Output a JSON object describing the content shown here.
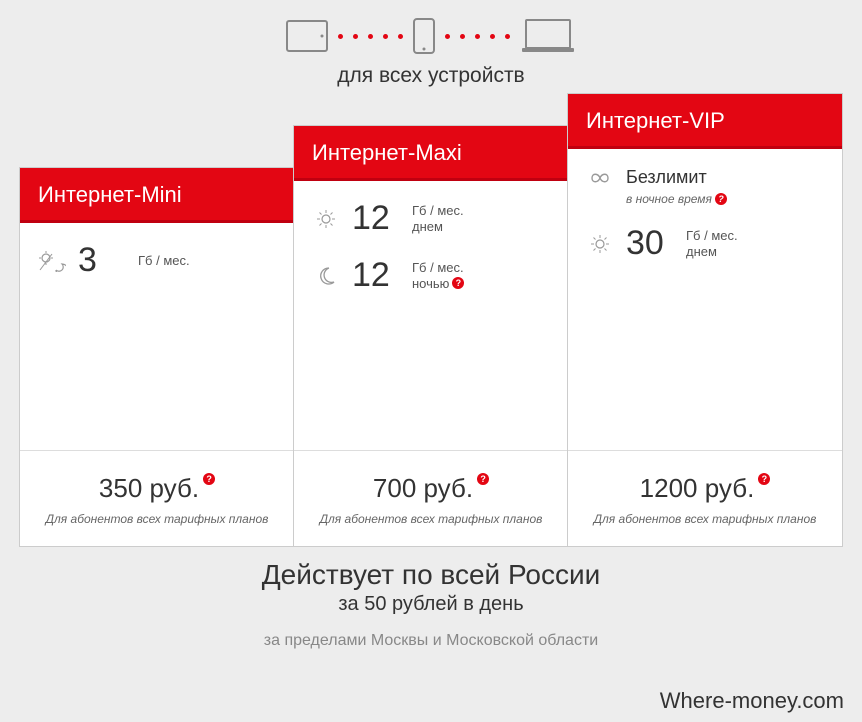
{
  "top": {
    "caption": "для всех устройств"
  },
  "plans": {
    "mini": {
      "title": "Интернет-Mini",
      "rows": [
        {
          "amount": "3",
          "unit_top": "Гб / мес.",
          "unit_bottom": ""
        }
      ],
      "price": "350 руб.",
      "bottom_sub": "Для абонентов всех тарифных планов"
    },
    "maxi": {
      "title": "Интернет-Maxi",
      "rows": [
        {
          "amount": "12",
          "unit_top": "Гб / мес.",
          "unit_bottom": "днем"
        },
        {
          "amount": "12",
          "unit_top": "Гб / мес.",
          "unit_bottom": "ночью"
        }
      ],
      "price": "700 руб.",
      "bottom_sub": "Для абонентов всех тарифных планов"
    },
    "vip": {
      "title": "Интернет-VIP",
      "unlimited_label": "Безлимит",
      "unlimited_sub": "в ночное время",
      "rows": [
        {
          "amount": "30",
          "unit_top": "Гб / мес.",
          "unit_bottom": "днем"
        }
      ],
      "price": "1200 руб.",
      "bottom_sub": "Для абонентов всех тарифных планов"
    }
  },
  "footer": {
    "title": "Действует по всей России",
    "sub1": "за 50 рублей в день",
    "sub2": "за пределами Москвы и Московской области"
  },
  "watermark": "Where-money.com"
}
